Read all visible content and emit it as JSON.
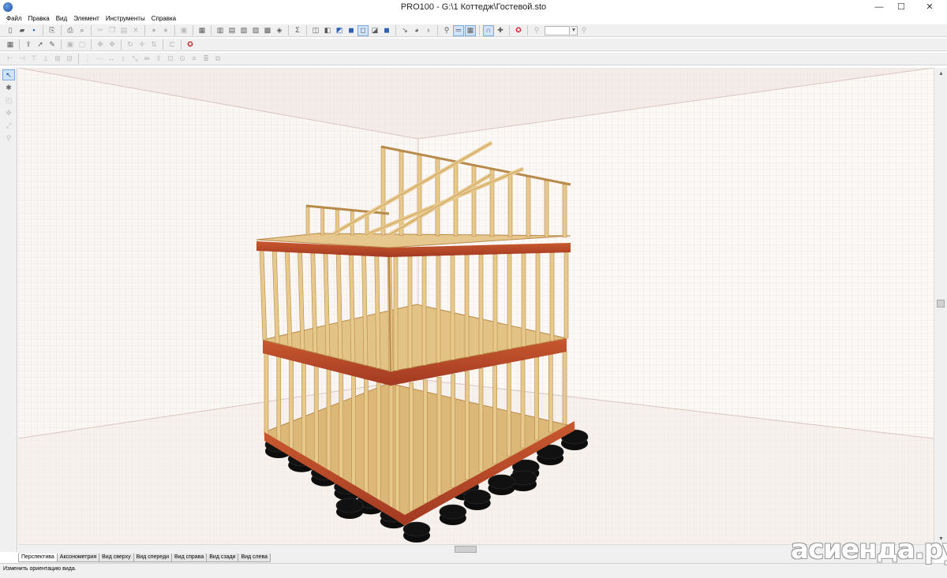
{
  "window": {
    "title": "PRO100 - G:\\1 Коттедж\\Гостевой.sto",
    "minimize": "—",
    "maximize": "☐",
    "close": "✕"
  },
  "menu": {
    "items": [
      "Файл",
      "Правка",
      "Вид",
      "Элемент",
      "Инструменты",
      "Справка"
    ]
  },
  "toolbars": {
    "row1_icons": [
      "new-file-icon",
      "open-folder-icon",
      "save-icon",
      "export-icon",
      "print-icon",
      "print-preview-icon",
      "cut-icon",
      "copy-icon",
      "paste-icon",
      "delete-icon",
      "undo-icon",
      "redo-icon",
      "properties-icon",
      "catalog-icon",
      "library-icon",
      "list-icon",
      "report-icon",
      "cost-icon",
      "order-icon",
      "sum-icon",
      "view-perspective-icon",
      "view-top-icon",
      "view-wire-icon",
      "view-solid-icon",
      "view-shaded-icon",
      "view-textured-icon",
      "view-realistic-icon",
      "dimension-icon",
      "light-icon",
      "bulb-icon",
      "measure-icon",
      "ruler-icon",
      "grid-icon",
      "magnet-icon",
      "snap-icon",
      "lifebuoy-icon",
      "zoom-out-icon",
      "zoom-in-icon"
    ],
    "zoom_value": ""
  },
  "left_tools": [
    "select-arrow-icon",
    "multi-select-icon",
    "rotate-icon",
    "move-icon",
    "scale-icon",
    "zoom-tool-icon"
  ],
  "tabs": [
    "Перспектива",
    "Аксонометрия",
    "Вид сверху",
    "Вид спереди",
    "Вид справа",
    "Вид сзади",
    "Вид слева"
  ],
  "active_tab": "Перспектива",
  "status": {
    "text": "Изменить ориентацию вида."
  },
  "watermark": {
    "text": "асиенда.ру"
  },
  "colors": {
    "wood": "#e8c98c",
    "wood_dark": "#b88a4a",
    "osb_red": "#b8462a",
    "floor": "#dcb878",
    "tire": "#111111",
    "grid": "#ead8d2"
  }
}
